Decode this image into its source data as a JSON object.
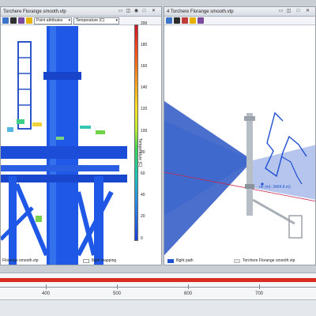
{
  "left_view": {
    "title": "Torchere Florange smooth.vtp",
    "coloring_mode": "Point attributes",
    "attribute": "Temperature (C)",
    "colorbar": {
      "label": "Temperature (C)",
      "ticks": [
        "200",
        "180",
        "160",
        "140",
        "120",
        "100",
        "80",
        "60",
        "40",
        "20",
        "0"
      ]
    },
    "legend": {
      "left_label": "Florange smooth.vtp",
      "right_label": "flight mapping"
    }
  },
  "right_view": {
    "title": "4 Torchere Florange smooth.vtp",
    "measurement_label": "ne (m): 3494.8 m)",
    "legend": {
      "left_label": "flight path",
      "right_label": "Torchere Florange smooth.vtp"
    }
  },
  "timeline": {
    "ticks": [
      "400",
      "500",
      "600",
      "700"
    ]
  },
  "colors": {
    "timeline_bar": "#d92b1f",
    "flight_path": "#1f4fd1",
    "pointcloud_blue": "#1f58e6"
  }
}
